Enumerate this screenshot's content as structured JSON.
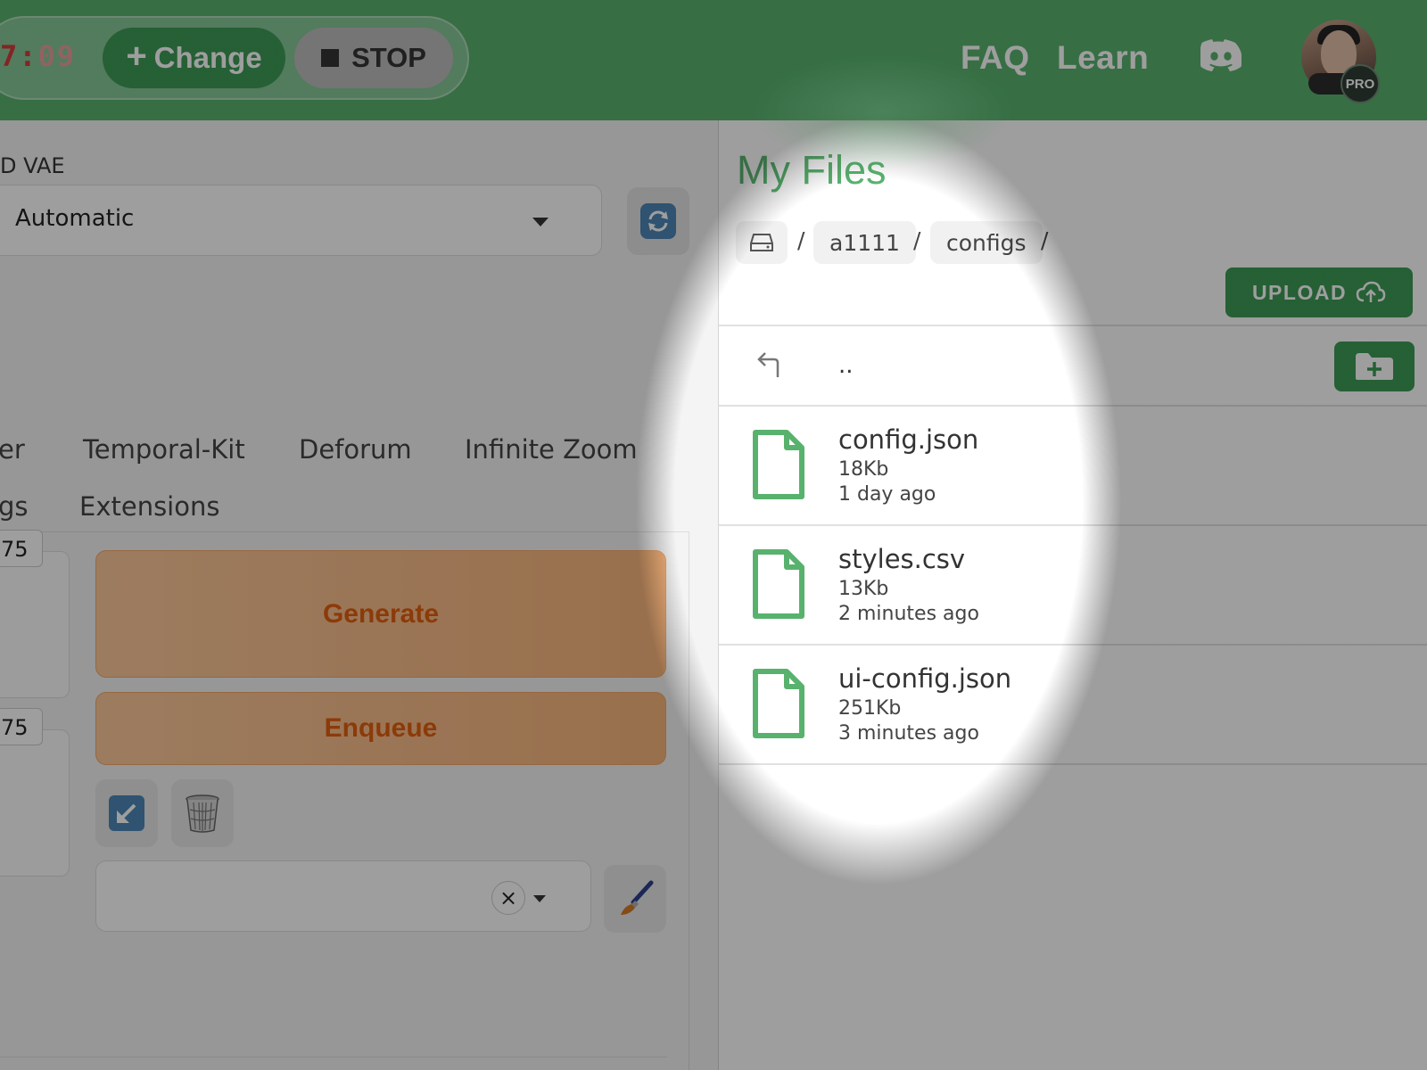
{
  "header": {
    "timer": {
      "main": "7:",
      "dim": "09"
    },
    "change_label": "Change",
    "stop_label": "STOP",
    "nav": {
      "faq": "FAQ",
      "learn": "Learn"
    },
    "pro_badge": "PRO"
  },
  "left": {
    "vae_label": "D VAE",
    "vae_value": "Automatic",
    "tabs_row1": [
      "er",
      "Temporal-Kit",
      "Deforum",
      "Infinite Zoom"
    ],
    "tabs_row2": [
      "gs",
      "Extensions"
    ],
    "badges": [
      "75",
      "75"
    ],
    "generate_label": "Generate",
    "enqueue_label": "Enqueue",
    "style_clear": "×"
  },
  "files": {
    "title": "My Files",
    "breadcrumb": [
      "a1111",
      "configs"
    ],
    "separator": "/",
    "upload_label": "UPLOAD",
    "parent_label": "..",
    "items": [
      {
        "name": "config.json",
        "size": "18Kb",
        "modified": "1 day ago"
      },
      {
        "name": "styles.csv",
        "size": "13Kb",
        "modified": "2 minutes ago"
      },
      {
        "name": "ui-config.json",
        "size": "251Kb",
        "modified": "3 minutes ago"
      }
    ]
  },
  "colors": {
    "brand_green": "#58b26e",
    "button_green": "#3d9a55",
    "generate_orange": "#f7b47b",
    "generate_text": "#e25e0e",
    "timer_red": "#d43c3c"
  },
  "icons": [
    "plus-icon",
    "stop-square-icon",
    "discord-icon",
    "refresh-icon",
    "drive-icon",
    "upload-cloud-icon",
    "return-arrow-icon",
    "new-folder-icon",
    "file-icon",
    "send-arrow-icon",
    "trash-icon",
    "brush-icon",
    "chevron-down-icon",
    "close-icon"
  ]
}
